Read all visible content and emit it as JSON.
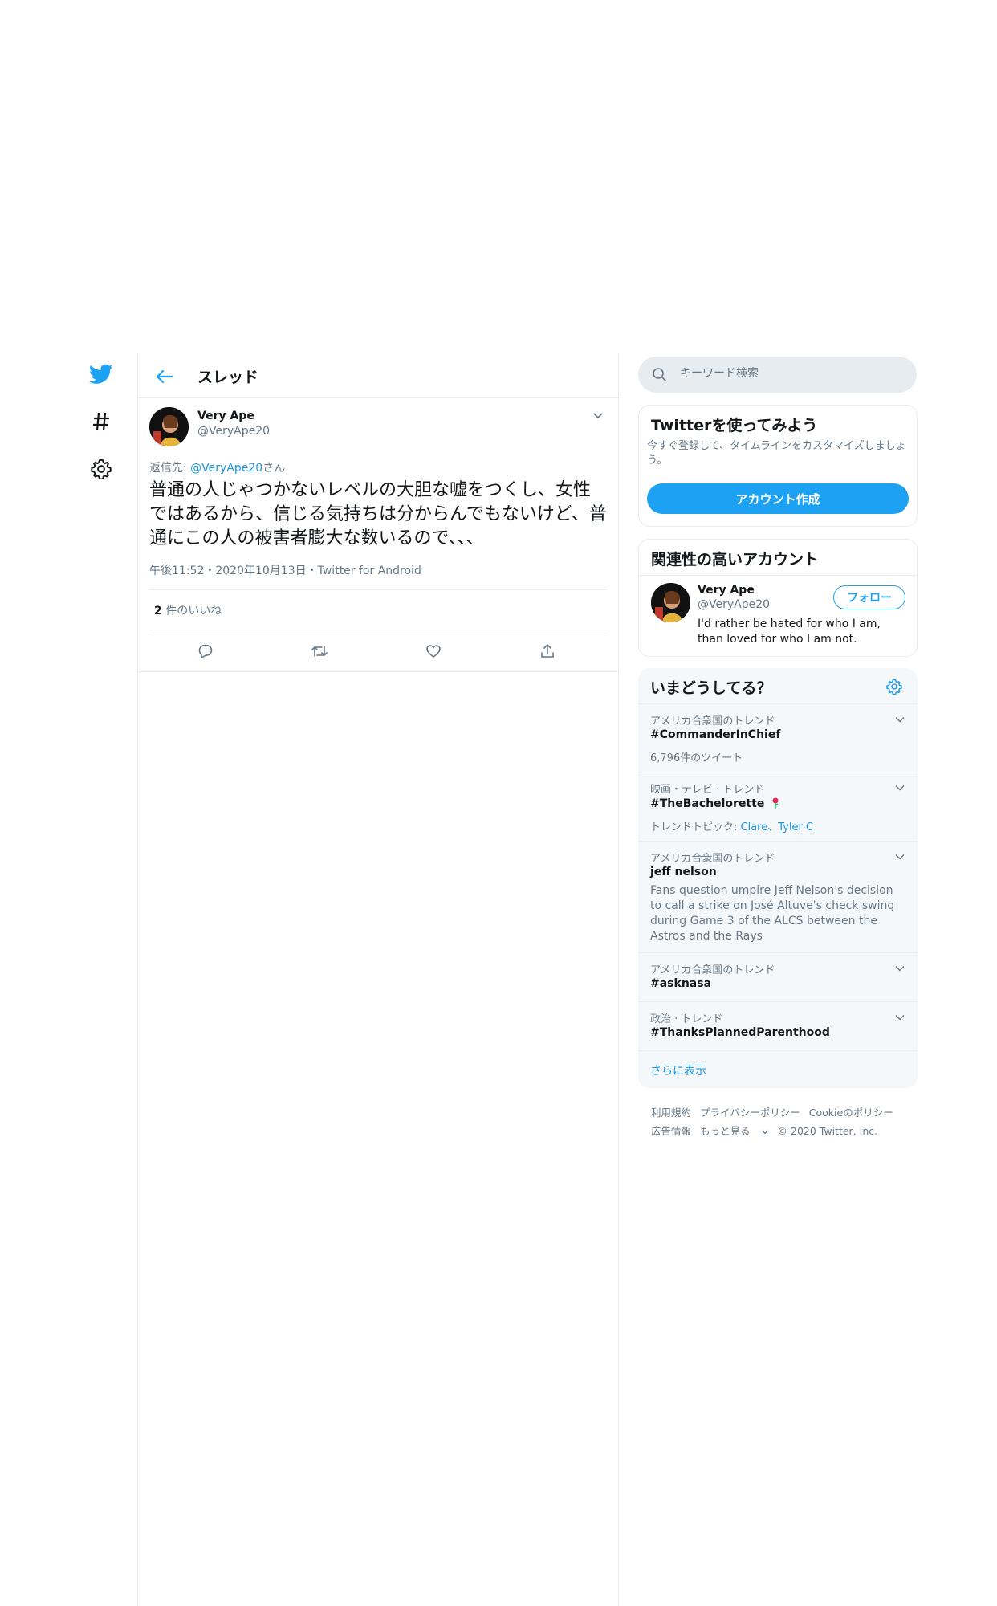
{
  "nav": {
    "logo_icon": "twitter-bird-icon",
    "explore_icon": "hashtag-icon",
    "settings_icon": "gear-icon"
  },
  "header": {
    "title": "スレッド"
  },
  "tweet": {
    "author_name": "Very Ape",
    "author_handle": "@VeryApe20",
    "reply_prefix": "返信先: ",
    "reply_handle": "@VeryApe20",
    "reply_suffix": "さん",
    "text": "普通の人じゃつかないレベルの大胆な嘘をつくし、女性ではあるから、信じる気持ちは分からんでもないけど、普通にこの人の被害者膨大な数いるので、、、",
    "time": "午後11:52",
    "date": "2020年10月13日",
    "source": "Twitter for Android",
    "separator": "・",
    "likes_count": "2",
    "likes_label": "件のいいね"
  },
  "search": {
    "placeholder": "キーワード検索"
  },
  "signup": {
    "title": "Twitterを使ってみよう",
    "description": "今すぐ登録して、タイムラインをカスタマイズしましょう。",
    "button": "アカウント作成"
  },
  "related": {
    "title": "関連性の高いアカウント",
    "name": "Very Ape",
    "handle": "@VeryApe20",
    "follow": "フォロー",
    "bio": "I'd rather be hated for who I am, than loved for who I am not."
  },
  "trends": {
    "title": "いまどうしてる？",
    "items": [
      {
        "context": "アメリカ合衆国のトレンド",
        "name": "#CommanderInChief",
        "sub": "6,796件のツイート"
      },
      {
        "context": "映画・テレビ · トレンド",
        "name": "#TheBachelorette",
        "sub_prefix": "トレンドトピック: ",
        "sub_links": "Clare、Tyler C"
      },
      {
        "context": "アメリカ合衆国のトレンド",
        "name": "jeff nelson",
        "desc": "Fans question umpire Jeff Nelson's decision to call a strike on José Altuve's check swing during Game 3 of the ALCS between the Astros and the Rays"
      },
      {
        "context": "アメリカ合衆国のトレンド",
        "name": "#asknasa"
      },
      {
        "context": "政治 · トレンド",
        "name": "#ThanksPlannedParenthood"
      }
    ],
    "show_more": "さらに表示"
  },
  "footer": {
    "row1": [
      "利用規約",
      "プライバシーポリシー",
      "Cookieのポリシー"
    ],
    "row2": [
      "広告情報",
      "もっと見る"
    ],
    "copyright": "© 2020 Twitter, Inc."
  },
  "colors": {
    "accent": "#1da1f2",
    "text": "#14171a",
    "muted": "#657786",
    "border": "#e6ecf0"
  }
}
